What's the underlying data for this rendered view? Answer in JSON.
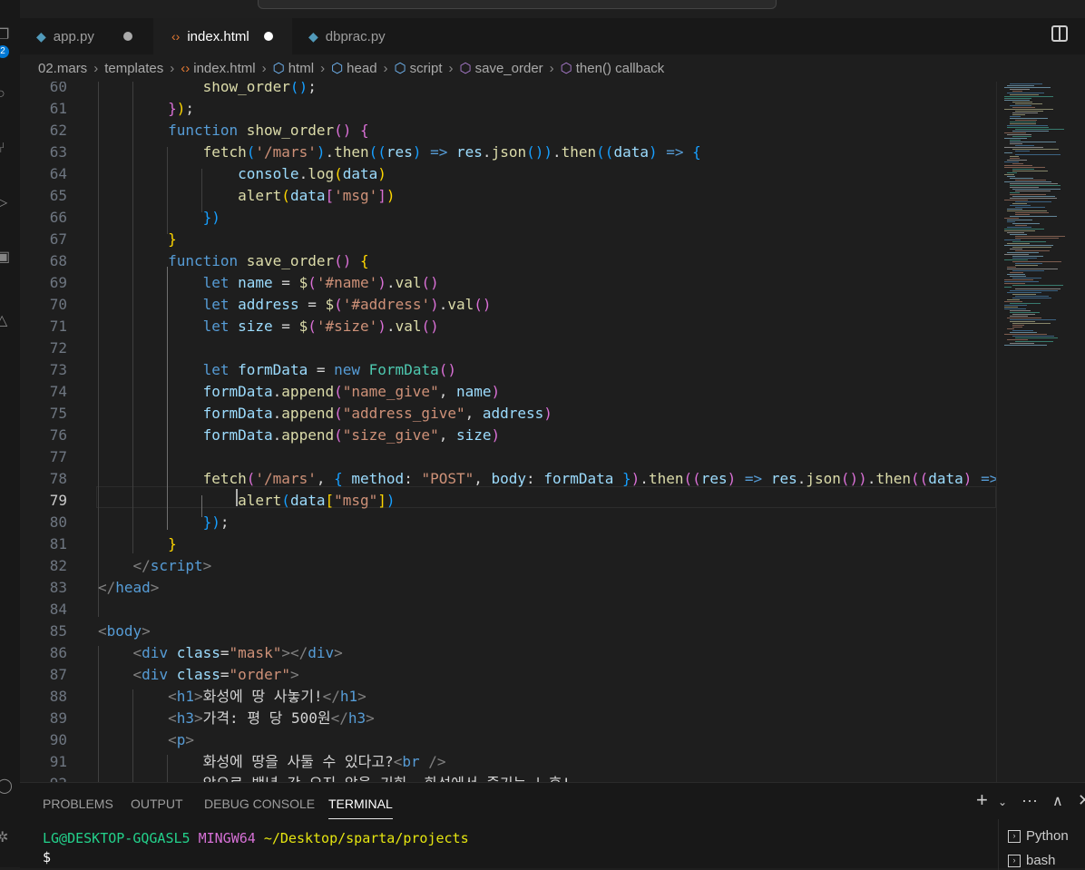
{
  "activity_bar": {
    "badge": "2"
  },
  "tabs": [
    {
      "label": "app.py",
      "icon": "python-icon",
      "modified": true
    },
    {
      "label": "index.html",
      "icon": "html-icon",
      "modified": true,
      "active": true
    },
    {
      "label": "dbprac.py",
      "icon": "python-icon",
      "modified": false
    }
  ],
  "breadcrumb": [
    "02.mars",
    "templates",
    "index.html",
    "html",
    "head",
    "script",
    "save_order",
    "then() callback"
  ],
  "editor": {
    "current_line": 79,
    "lines": [
      {
        "n": 60,
        "t": [
          [
            "s",
            "            "
          ],
          [
            "fn",
            "show_order"
          ],
          [
            "b3",
            "()"
          ],
          [
            "def",
            ";"
          ]
        ]
      },
      {
        "n": 61,
        "t": [
          [
            "s",
            "        "
          ],
          [
            "b2",
            "}"
          ],
          [
            "b1",
            ")"
          ],
          [
            "def",
            ";"
          ]
        ]
      },
      {
        "n": 62,
        "t": [
          [
            "s",
            "        "
          ],
          [
            "kw",
            "function"
          ],
          [
            "def",
            " "
          ],
          [
            "fn",
            "show_order"
          ],
          [
            "b2",
            "()"
          ],
          [
            "def",
            " "
          ],
          [
            "b2",
            "{"
          ]
        ]
      },
      {
        "n": 63,
        "t": [
          [
            "s",
            "            "
          ],
          [
            "fn",
            "fetch"
          ],
          [
            "b3",
            "("
          ],
          [
            "str",
            "'/mars'"
          ],
          [
            "b3",
            ")"
          ],
          [
            "def",
            "."
          ],
          [
            "fn",
            "then"
          ],
          [
            "b3",
            "(("
          ],
          [
            "var",
            "res"
          ],
          [
            "b3",
            ")"
          ],
          [
            "def",
            " "
          ],
          [
            "kw",
            "=>"
          ],
          [
            "def",
            " "
          ],
          [
            "var",
            "res"
          ],
          [
            "def",
            "."
          ],
          [
            "fn",
            "json"
          ],
          [
            "b3",
            "())"
          ],
          [
            "def",
            "."
          ],
          [
            "fn",
            "then"
          ],
          [
            "b3",
            "(("
          ],
          [
            "var",
            "data"
          ],
          [
            "b3",
            ")"
          ],
          [
            "def",
            " "
          ],
          [
            "kw",
            "=>"
          ],
          [
            "def",
            " "
          ],
          [
            "b3",
            "{"
          ]
        ]
      },
      {
        "n": 64,
        "t": [
          [
            "s",
            "                "
          ],
          [
            "var",
            "console"
          ],
          [
            "def",
            "."
          ],
          [
            "fn",
            "log"
          ],
          [
            "b1",
            "("
          ],
          [
            "var",
            "data"
          ],
          [
            "b1",
            ")"
          ]
        ]
      },
      {
        "n": 65,
        "t": [
          [
            "s",
            "                "
          ],
          [
            "fn",
            "alert"
          ],
          [
            "b1",
            "("
          ],
          [
            "var",
            "data"
          ],
          [
            "b2",
            "["
          ],
          [
            "str",
            "'msg'"
          ],
          [
            "b2",
            "]"
          ],
          [
            "b1",
            ")"
          ]
        ]
      },
      {
        "n": 66,
        "t": [
          [
            "s",
            "            "
          ],
          [
            "b3",
            "})"
          ]
        ]
      },
      {
        "n": 67,
        "t": [
          [
            "s",
            "        "
          ],
          [
            "b1",
            "}"
          ]
        ]
      },
      {
        "n": 68,
        "t": [
          [
            "s",
            "        "
          ],
          [
            "kw",
            "function"
          ],
          [
            "def",
            " "
          ],
          [
            "fn",
            "save_order"
          ],
          [
            "b2",
            "()"
          ],
          [
            "def",
            " "
          ],
          [
            "b1",
            "{"
          ]
        ]
      },
      {
        "n": 69,
        "t": [
          [
            "s",
            "            "
          ],
          [
            "kw",
            "let"
          ],
          [
            "def",
            " "
          ],
          [
            "var",
            "name"
          ],
          [
            "def",
            " = "
          ],
          [
            "fn",
            "$"
          ],
          [
            "b2",
            "("
          ],
          [
            "str",
            "'#name'"
          ],
          [
            "b2",
            ")"
          ],
          [
            "def",
            "."
          ],
          [
            "fn",
            "val"
          ],
          [
            "b2",
            "()"
          ]
        ]
      },
      {
        "n": 70,
        "t": [
          [
            "s",
            "            "
          ],
          [
            "kw",
            "let"
          ],
          [
            "def",
            " "
          ],
          [
            "var",
            "address"
          ],
          [
            "def",
            " = "
          ],
          [
            "fn",
            "$"
          ],
          [
            "b2",
            "("
          ],
          [
            "str",
            "'#address'"
          ],
          [
            "b2",
            ")"
          ],
          [
            "def",
            "."
          ],
          [
            "fn",
            "val"
          ],
          [
            "b2",
            "()"
          ]
        ]
      },
      {
        "n": 71,
        "t": [
          [
            "s",
            "            "
          ],
          [
            "kw",
            "let"
          ],
          [
            "def",
            " "
          ],
          [
            "var",
            "size"
          ],
          [
            "def",
            " = "
          ],
          [
            "fn",
            "$"
          ],
          [
            "b2",
            "("
          ],
          [
            "str",
            "'#size'"
          ],
          [
            "b2",
            ")"
          ],
          [
            "def",
            "."
          ],
          [
            "fn",
            "val"
          ],
          [
            "b2",
            "()"
          ]
        ]
      },
      {
        "n": 72,
        "t": []
      },
      {
        "n": 73,
        "t": [
          [
            "s",
            "            "
          ],
          [
            "kw",
            "let"
          ],
          [
            "def",
            " "
          ],
          [
            "var",
            "formData"
          ],
          [
            "def",
            " = "
          ],
          [
            "kw",
            "new"
          ],
          [
            "def",
            " "
          ],
          [
            "cls",
            "FormData"
          ],
          [
            "b2",
            "()"
          ]
        ]
      },
      {
        "n": 74,
        "t": [
          [
            "s",
            "            "
          ],
          [
            "var",
            "formData"
          ],
          [
            "def",
            "."
          ],
          [
            "fn",
            "append"
          ],
          [
            "b2",
            "("
          ],
          [
            "str",
            "\"name_give\""
          ],
          [
            "def",
            ", "
          ],
          [
            "var",
            "name"
          ],
          [
            "b2",
            ")"
          ]
        ]
      },
      {
        "n": 75,
        "t": [
          [
            "s",
            "            "
          ],
          [
            "var",
            "formData"
          ],
          [
            "def",
            "."
          ],
          [
            "fn",
            "append"
          ],
          [
            "b2",
            "("
          ],
          [
            "str",
            "\"address_give\""
          ],
          [
            "def",
            ", "
          ],
          [
            "var",
            "address"
          ],
          [
            "b2",
            ")"
          ]
        ]
      },
      {
        "n": 76,
        "t": [
          [
            "s",
            "            "
          ],
          [
            "var",
            "formData"
          ],
          [
            "def",
            "."
          ],
          [
            "fn",
            "append"
          ],
          [
            "b2",
            "("
          ],
          [
            "str",
            "\"size_give\""
          ],
          [
            "def",
            ", "
          ],
          [
            "var",
            "size"
          ],
          [
            "b2",
            ")"
          ]
        ]
      },
      {
        "n": 77,
        "t": []
      },
      {
        "n": 78,
        "t": [
          [
            "s",
            "            "
          ],
          [
            "fn",
            "fetch"
          ],
          [
            "b2",
            "("
          ],
          [
            "str",
            "'/mars'"
          ],
          [
            "def",
            ", "
          ],
          [
            "b3",
            "{"
          ],
          [
            "def",
            " "
          ],
          [
            "var",
            "method"
          ],
          [
            "def",
            ": "
          ],
          [
            "str",
            "\"POST\""
          ],
          [
            "def",
            ", "
          ],
          [
            "var",
            "body"
          ],
          [
            "def",
            ": "
          ],
          [
            "var",
            "formData"
          ],
          [
            "def",
            " "
          ],
          [
            "b3",
            "}"
          ],
          [
            "b2",
            ")"
          ],
          [
            "def",
            "."
          ],
          [
            "fn",
            "then"
          ],
          [
            "b2",
            "(("
          ],
          [
            "var",
            "res"
          ],
          [
            "b2",
            ")"
          ],
          [
            "def",
            " "
          ],
          [
            "kw",
            "=>"
          ],
          [
            "def",
            " "
          ],
          [
            "var",
            "res"
          ],
          [
            "def",
            "."
          ],
          [
            "fn",
            "json"
          ],
          [
            "b2",
            "())"
          ],
          [
            "def",
            "."
          ],
          [
            "fn",
            "then"
          ],
          [
            "b2",
            "(("
          ],
          [
            "var",
            "data"
          ],
          [
            "b2",
            ")"
          ],
          [
            "def",
            " "
          ],
          [
            "kw",
            "=>"
          ]
        ]
      },
      {
        "n": 79,
        "t": [
          [
            "s",
            "                "
          ],
          [
            "fn",
            "alert"
          ],
          [
            "b3",
            "("
          ],
          [
            "var",
            "data"
          ],
          [
            "b1",
            "["
          ],
          [
            "str",
            "\"msg\""
          ],
          [
            "b1",
            "]"
          ],
          [
            "b3",
            ")"
          ]
        ]
      },
      {
        "n": 80,
        "t": [
          [
            "s",
            "            "
          ],
          [
            "b3",
            "})"
          ],
          [
            "def",
            ";"
          ]
        ]
      },
      {
        "n": 81,
        "t": [
          [
            "s",
            "        "
          ],
          [
            "b1",
            "}"
          ]
        ]
      },
      {
        "n": 82,
        "t": [
          [
            "s",
            "    "
          ],
          [
            "tagb",
            "</"
          ],
          [
            "tag",
            "script"
          ],
          [
            "tagb",
            ">"
          ]
        ]
      },
      {
        "n": 83,
        "t": [
          [
            "tagb",
            "</"
          ],
          [
            "tag",
            "head"
          ],
          [
            "tagb",
            ">"
          ]
        ]
      },
      {
        "n": 84,
        "t": []
      },
      {
        "n": 85,
        "t": [
          [
            "tagb",
            "<"
          ],
          [
            "tag",
            "body"
          ],
          [
            "tagb",
            ">"
          ]
        ]
      },
      {
        "n": 86,
        "t": [
          [
            "s",
            "    "
          ],
          [
            "tagb",
            "<"
          ],
          [
            "tag",
            "div"
          ],
          [
            "def",
            " "
          ],
          [
            "attr",
            "class"
          ],
          [
            "def",
            "="
          ],
          [
            "str",
            "\"mask\""
          ],
          [
            "tagb",
            "></"
          ],
          [
            "tag",
            "div"
          ],
          [
            "tagb",
            ">"
          ]
        ]
      },
      {
        "n": 87,
        "t": [
          [
            "s",
            "    "
          ],
          [
            "tagb",
            "<"
          ],
          [
            "tag",
            "div"
          ],
          [
            "def",
            " "
          ],
          [
            "attr",
            "class"
          ],
          [
            "def",
            "="
          ],
          [
            "str",
            "\"order\""
          ],
          [
            "tagb",
            ">"
          ]
        ]
      },
      {
        "n": 88,
        "t": [
          [
            "s",
            "        "
          ],
          [
            "tagb",
            "<"
          ],
          [
            "tag",
            "h1"
          ],
          [
            "tagb",
            ">"
          ],
          [
            "def",
            "화성에 땅 사놓기!"
          ],
          [
            "tagb",
            "</"
          ],
          [
            "tag",
            "h1"
          ],
          [
            "tagb",
            ">"
          ]
        ]
      },
      {
        "n": 89,
        "t": [
          [
            "s",
            "        "
          ],
          [
            "tagb",
            "<"
          ],
          [
            "tag",
            "h3"
          ],
          [
            "tagb",
            ">"
          ],
          [
            "def",
            "가격: 평 당 500원"
          ],
          [
            "tagb",
            "</"
          ],
          [
            "tag",
            "h3"
          ],
          [
            "tagb",
            ">"
          ]
        ]
      },
      {
        "n": 90,
        "t": [
          [
            "s",
            "        "
          ],
          [
            "tagb",
            "<"
          ],
          [
            "tag",
            "p"
          ],
          [
            "tagb",
            ">"
          ]
        ]
      },
      {
        "n": 91,
        "t": [
          [
            "s",
            "            "
          ],
          [
            "def",
            "화성에 땅을 사둘 수 있다고?"
          ],
          [
            "tagb",
            "<"
          ],
          [
            "tag",
            "br"
          ],
          [
            "def",
            " "
          ],
          [
            "tagb",
            "/>"
          ]
        ]
      },
      {
        "n": 92,
        "t": [
          [
            "s",
            "            "
          ],
          [
            "def",
            "앞으로 백년 간 오지 않을 기회. 화성에서 즐기는 노후!"
          ]
        ]
      }
    ]
  },
  "panel": {
    "tabs": [
      "PROBLEMS",
      "OUTPUT",
      "DEBUG CONSOLE",
      "TERMINAL"
    ],
    "active_tab": "TERMINAL",
    "prompt_user": "LG@DESKTOP-GQGASL5",
    "prompt_env": "MINGW64",
    "prompt_path": "~/Desktop/sparta/projects",
    "prompt_symbol": "$",
    "terminals": [
      "Python",
      "bash"
    ]
  }
}
